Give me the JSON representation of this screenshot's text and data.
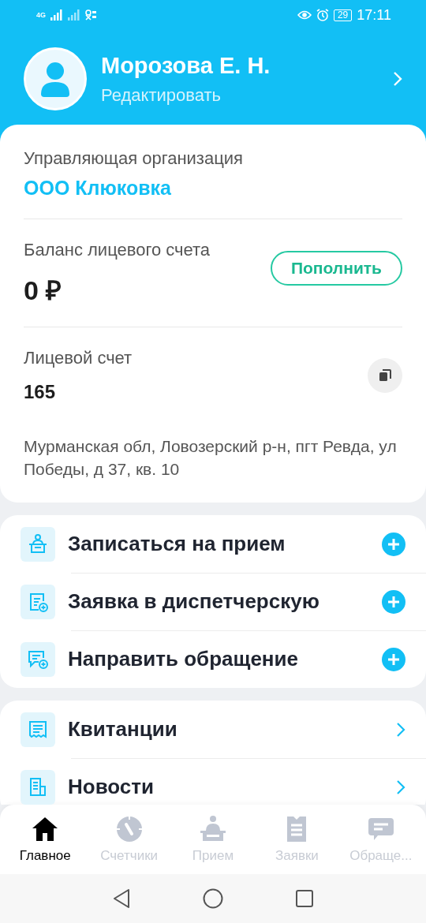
{
  "status_bar": {
    "network": "4G",
    "battery": "29",
    "time": "17:11"
  },
  "profile": {
    "name": "Морозова Е. Н.",
    "edit_link": "Редактировать"
  },
  "account_card": {
    "org_label": "Управляющая организация",
    "org_name": "ООО Клюковка",
    "balance_label": "Баланс лицевого счета",
    "balance": "0 ₽",
    "top_up_button": "Пополнить",
    "account_label": "Лицевой счет",
    "account_number": "165",
    "address": "Мурманская обл, Ловозерский р-н, пгт Ревда, ул Победы, д 37, кв. 10"
  },
  "actions": [
    {
      "label": "Записаться на прием"
    },
    {
      "label": "Заявка в диспетчерскую"
    },
    {
      "label": "Направить обращение"
    }
  ],
  "links": [
    {
      "label": "Квитанции"
    },
    {
      "label": "Новости"
    }
  ],
  "bottom_nav": [
    {
      "label": "Главное",
      "selected": true
    },
    {
      "label": "Счетчики",
      "selected": false
    },
    {
      "label": "Прием",
      "selected": false
    },
    {
      "label": "Заявки",
      "selected": false
    },
    {
      "label": "Обраще...",
      "selected": false
    }
  ]
}
